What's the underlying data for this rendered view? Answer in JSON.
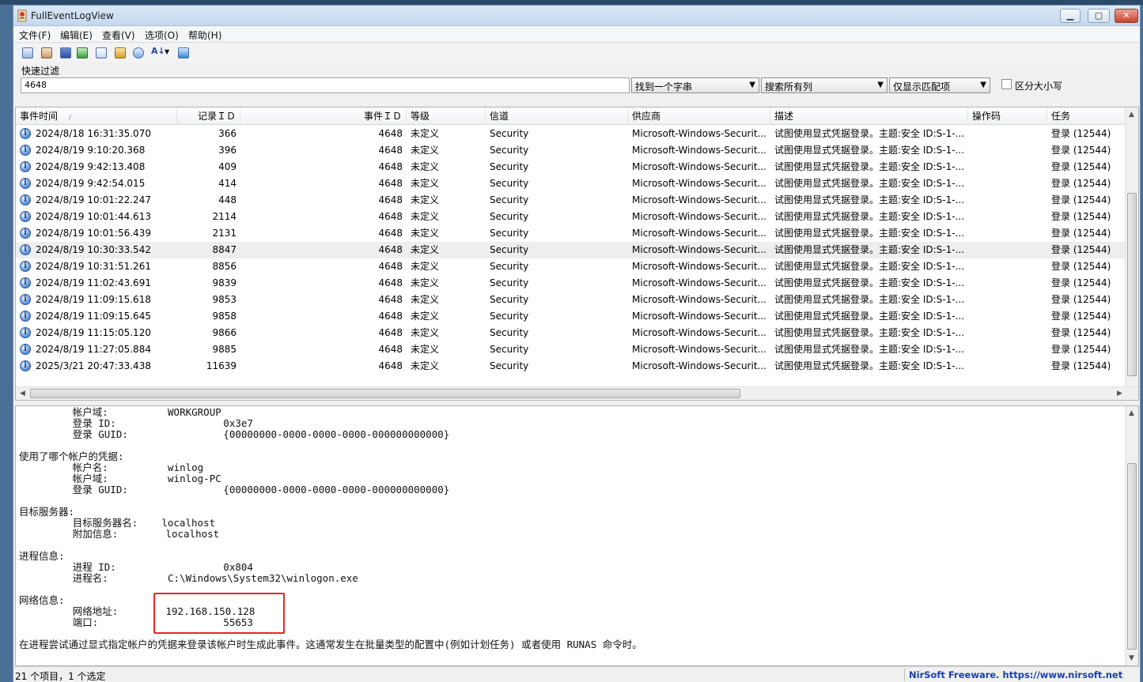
{
  "window": {
    "title": "FullEventLogView"
  },
  "menu": [
    "文件(F)",
    "编辑(E)",
    "查看(V)",
    "选项(O)",
    "帮助(H)"
  ],
  "toolbar_icons": [
    "properties-icon",
    "event-log-icon",
    "save-icon",
    "refresh-icon",
    "copy-icon",
    "options-icon",
    "find-icon",
    "sort-icon",
    "exit-icon"
  ],
  "filter": {
    "label": "快速过滤",
    "value": "4648",
    "mode": "找到一个字串",
    "columns": "搜索所有列",
    "display": "仅显示匹配项",
    "case_label": "区分大小写"
  },
  "table": {
    "columns": [
      "事件时间",
      "记录ＩＤ",
      "事件ＩＤ",
      "等级",
      "信道",
      "供应商",
      "描述",
      "操作码",
      "任务"
    ],
    "rows": [
      [
        "2024/8/18 16:31:35.070",
        "366",
        "4648",
        "未定义",
        "Security",
        "Microsoft-Windows-Securit...",
        "试图使用显式凭据登录。主题:安全 ID:S-1-...",
        "",
        "登录 (12544)"
      ],
      [
        "2024/8/19 9:10:20.368",
        "396",
        "4648",
        "未定义",
        "Security",
        "Microsoft-Windows-Securit...",
        "试图使用显式凭据登录。主题:安全 ID:S-1-...",
        "",
        "登录 (12544)"
      ],
      [
        "2024/8/19 9:42:13.408",
        "409",
        "4648",
        "未定义",
        "Security",
        "Microsoft-Windows-Securit...",
        "试图使用显式凭据登录。主题:安全 ID:S-1-...",
        "",
        "登录 (12544)"
      ],
      [
        "2024/8/19 9:42:54.015",
        "414",
        "4648",
        "未定义",
        "Security",
        "Microsoft-Windows-Securit...",
        "试图使用显式凭据登录。主题:安全 ID:S-1-...",
        "",
        "登录 (12544)"
      ],
      [
        "2024/8/19 10:01:22.247",
        "448",
        "4648",
        "未定义",
        "Security",
        "Microsoft-Windows-Securit...",
        "试图使用显式凭据登录。主题:安全 ID:S-1-...",
        "",
        "登录 (12544)"
      ],
      [
        "2024/8/19 10:01:44.613",
        "2114",
        "4648",
        "未定义",
        "Security",
        "Microsoft-Windows-Securit...",
        "试图使用显式凭据登录。主题:安全 ID:S-1-...",
        "",
        "登录 (12544)"
      ],
      [
        "2024/8/19 10:01:56.439",
        "2131",
        "4648",
        "未定义",
        "Security",
        "Microsoft-Windows-Securit...",
        "试图使用显式凭据登录。主题:安全 ID:S-1-...",
        "",
        "登录 (12544)"
      ],
      [
        "2024/8/19 10:30:33.542",
        "8847",
        "4648",
        "未定义",
        "Security",
        "Microsoft-Windows-Securit...",
        "试图使用显式凭据登录。主题:安全 ID:S-1-...",
        "",
        "登录 (12544)"
      ],
      [
        "2024/8/19 10:31:51.261",
        "8856",
        "4648",
        "未定义",
        "Security",
        "Microsoft-Windows-Securit...",
        "试图使用显式凭据登录。主题:安全 ID:S-1-...",
        "",
        "登录 (12544)"
      ],
      [
        "2024/8/19 11:02:43.691",
        "9839",
        "4648",
        "未定义",
        "Security",
        "Microsoft-Windows-Securit...",
        "试图使用显式凭据登录。主题:安全 ID:S-1-...",
        "",
        "登录 (12544)"
      ],
      [
        "2024/8/19 11:09:15.618",
        "9853",
        "4648",
        "未定义",
        "Security",
        "Microsoft-Windows-Securit...",
        "试图使用显式凭据登录。主题:安全 ID:S-1-...",
        "",
        "登录 (12544)"
      ],
      [
        "2024/8/19 11:09:15.645",
        "9858",
        "4648",
        "未定义",
        "Security",
        "Microsoft-Windows-Securit...",
        "试图使用显式凭据登录。主题:安全 ID:S-1-...",
        "",
        "登录 (12544)"
      ],
      [
        "2024/8/19 11:15:05.120",
        "9866",
        "4648",
        "未定义",
        "Security",
        "Microsoft-Windows-Securit...",
        "试图使用显式凭据登录。主题:安全 ID:S-1-...",
        "",
        "登录 (12544)"
      ],
      [
        "2024/8/19 11:27:05.884",
        "9885",
        "4648",
        "未定义",
        "Security",
        "Microsoft-Windows-Securit...",
        "试图使用显式凭据登录。主题:安全 ID:S-1-...",
        "",
        "登录 (12544)"
      ],
      [
        "2025/3/21 20:47:33.438",
        "11639",
        "4648",
        "未定义",
        "Security",
        "Microsoft-Windows-Securit...",
        "试图使用显式凭据登录。主题:安全 ID:S-1-...",
        "",
        "登录 (12544)"
      ]
    ],
    "selected_row": 7
  },
  "detail": {
    "text": "         帐户域:          WORKGROUP\n         登录 ID:                  0x3e7\n         登录 GUID:                {00000000-0000-0000-0000-000000000000}\n\n使用了哪个帐户的凭据:\n         帐户名:          winlog\n         帐户域:          winlog-PC\n         登录 GUID:                {00000000-0000-0000-0000-000000000000}\n\n目标服务器:\n         目标服务器名:    localhost\n         附加信息:        localhost\n\n进程信息:\n         进程 ID:                  0x804\n         进程名:          C:\\Windows\\System32\\winlogon.exe\n\n网络信息:\n         网络地址:        192.168.150.128\n         端口:                     55653\n\n在进程尝试通过显式指定帐户的凭据来登录该帐户时生成此事件。这通常发生在批量类型的配置中(例如计划任务) 或者使用 RUNAS 命令时。"
  },
  "status": {
    "left": "21 个项目，1 个选定",
    "right": "NirSoft Freeware. https://www.nirsoft.net"
  }
}
